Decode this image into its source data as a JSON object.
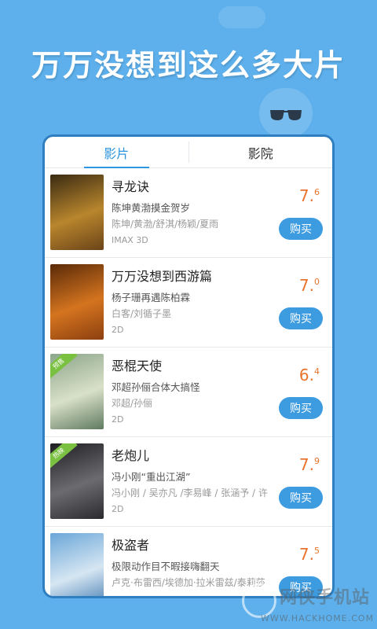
{
  "headline": "万万没想到这么多大片",
  "tabs": [
    {
      "label": "影片",
      "active": true
    },
    {
      "label": "影院",
      "active": false
    }
  ],
  "movies": [
    {
      "title": "寻龙诀",
      "tagline": "陈坤黄渤摸金贺岁",
      "cast": "陈坤/黄渤/舒淇/杨颖/夏雨",
      "format": "IMAX 3D",
      "score_int": "7.",
      "score_dec": "6",
      "buy_label": "购买",
      "poster_colors": [
        "#3a2a12",
        "#b8862d",
        "#6b4318"
      ],
      "ribbon": ""
    },
    {
      "title": "万万没想到西游篇",
      "tagline": "杨子珊再遇陈柏霖",
      "cast": "白客/刘循子墨",
      "format": "2D",
      "score_int": "7.",
      "score_dec": "0",
      "buy_label": "购买",
      "poster_colors": [
        "#5a2a08",
        "#d4741f",
        "#8c3f10"
      ],
      "ribbon": ""
    },
    {
      "title": "恶棍天使",
      "tagline": "邓超孙俪合体大搞怪",
      "cast": "邓超/孙俪",
      "format": "2D",
      "score_int": "6.",
      "score_dec": "4",
      "buy_label": "购买",
      "poster_colors": [
        "#8aa58a",
        "#d9e0c9",
        "#5f7a60"
      ],
      "ribbon": "预售"
    },
    {
      "title": "老炮儿",
      "tagline": "冯小刚“重出江湖”",
      "cast": "冯小刚 / 吴亦凡 /李易峰 / 张涵予 / 许...",
      "format": "2D",
      "score_int": "7.",
      "score_dec": "9",
      "buy_label": "购买",
      "poster_colors": [
        "#1f1f22",
        "#6b6b70",
        "#2a2a2e"
      ],
      "ribbon": "热映"
    },
    {
      "title": "极盗者",
      "tagline": "极限动作目不暇接嗨翻天",
      "cast": "卢克·布雷西/埃德加·拉米雷兹/泰莉莎",
      "format": "",
      "score_int": "7.",
      "score_dec": "5",
      "buy_label": "购买",
      "poster_colors": [
        "#6aa6d8",
        "#d6e6f2",
        "#3f79b0"
      ],
      "ribbon": ""
    }
  ],
  "watermark": {
    "text": "网侠手机站",
    "url": "WWW.HACKHOME.COM"
  }
}
